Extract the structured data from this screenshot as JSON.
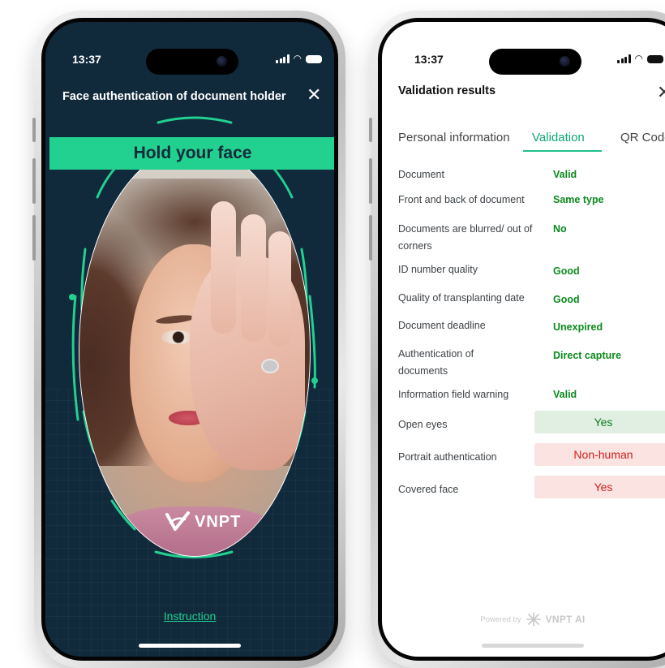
{
  "left_phone": {
    "status_time": "13:37",
    "title": "Face authentication of document holder",
    "close_icon": "close-icon",
    "banner_text": "Hold your face",
    "logo_text": "VNPT",
    "instruction_link": "Instruction",
    "colors": {
      "background": "#10293b",
      "accent": "#22d08f"
    }
  },
  "right_phone": {
    "status_time": "13:37",
    "title": "Validation results",
    "close_icon": "close-icon",
    "tabs": [
      {
        "label": "Personal information",
        "active": false
      },
      {
        "label": "Validation",
        "active": true
      },
      {
        "label": "QR Code",
        "active": false
      }
    ],
    "rows": [
      {
        "label": "Document",
        "value": "Valid"
      },
      {
        "label": "Front and back of document",
        "value": "Same type"
      },
      {
        "label": "Documents are blurred/ out of corners",
        "value": "No"
      },
      {
        "label": "ID number quality",
        "value": "Good"
      },
      {
        "label": "Quality of transplanting date",
        "value": "Good"
      },
      {
        "label": "Document deadline",
        "value": "Unexpired"
      },
      {
        "label": "Authentication of documents",
        "value": "Direct capture"
      },
      {
        "label": "Information field warning",
        "value": "Valid"
      }
    ],
    "badges": [
      {
        "label": "Open eyes",
        "value": "Yes",
        "status": "green"
      },
      {
        "label": "Portrait authentication",
        "value": "Non-human",
        "status": "red"
      },
      {
        "label": "Covered face",
        "value": "Yes",
        "status": "red"
      }
    ],
    "footer": {
      "powered_by": "Powered by",
      "brand": "VNPT AI"
    },
    "colors": {
      "accent": "#0ea775",
      "value_green": "#0b8a1e",
      "badge_red": "#d21f1f"
    }
  }
}
